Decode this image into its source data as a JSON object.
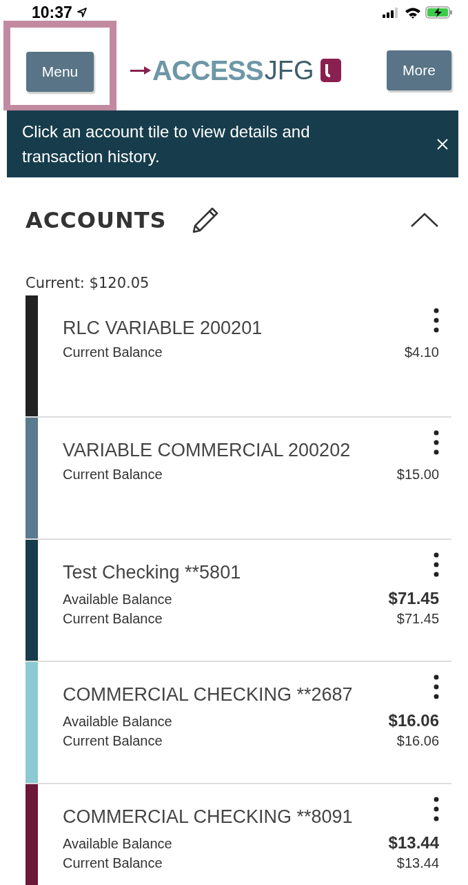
{
  "status_bar": {
    "time": "10:37"
  },
  "header": {
    "menu_button": {
      "label": "Menu",
      "highlighted": true
    },
    "logo": {
      "word": "ACCESS",
      "suffix": "JFG"
    },
    "more_button": {
      "label": "More"
    }
  },
  "banner": {
    "message": "Click an account tile to view details and transaction history."
  },
  "accounts": {
    "title": "ACCOUNTS",
    "expanded": true,
    "total": "Current: $120.05",
    "items": [
      {
        "name": "RLC VARIABLE 200201",
        "color": "#222222",
        "balances": [
          {
            "label": "Current Balance",
            "amount": "$4.10",
            "emphasis": false
          }
        ]
      },
      {
        "name": "VARIABLE COMMERCIAL 200202",
        "color": "#5a7a8f",
        "balances": [
          {
            "label": "Current Balance",
            "amount": "$15.00",
            "emphasis": false
          }
        ]
      },
      {
        "name": "Test Checking **5801",
        "color": "#173d4c",
        "balances": [
          {
            "label": "Available Balance",
            "amount": "$71.45",
            "emphasis": true
          },
          {
            "label": "Current Balance",
            "amount": "$71.45",
            "emphasis": false
          }
        ]
      },
      {
        "name": "COMMERCIAL CHECKING **2687",
        "color": "#8ccad3",
        "balances": [
          {
            "label": "Available Balance",
            "amount": "$16.06",
            "emphasis": true
          },
          {
            "label": "Current Balance",
            "amount": "$16.06",
            "emphasis": false
          }
        ]
      },
      {
        "name": "COMMERCIAL CHECKING **8091",
        "color": "#6b1839",
        "balances": [
          {
            "label": "Available Balance",
            "amount": "$13.44",
            "emphasis": true
          },
          {
            "label": "Current Balance",
            "amount": "$13.44",
            "emphasis": false
          }
        ]
      }
    ]
  }
}
